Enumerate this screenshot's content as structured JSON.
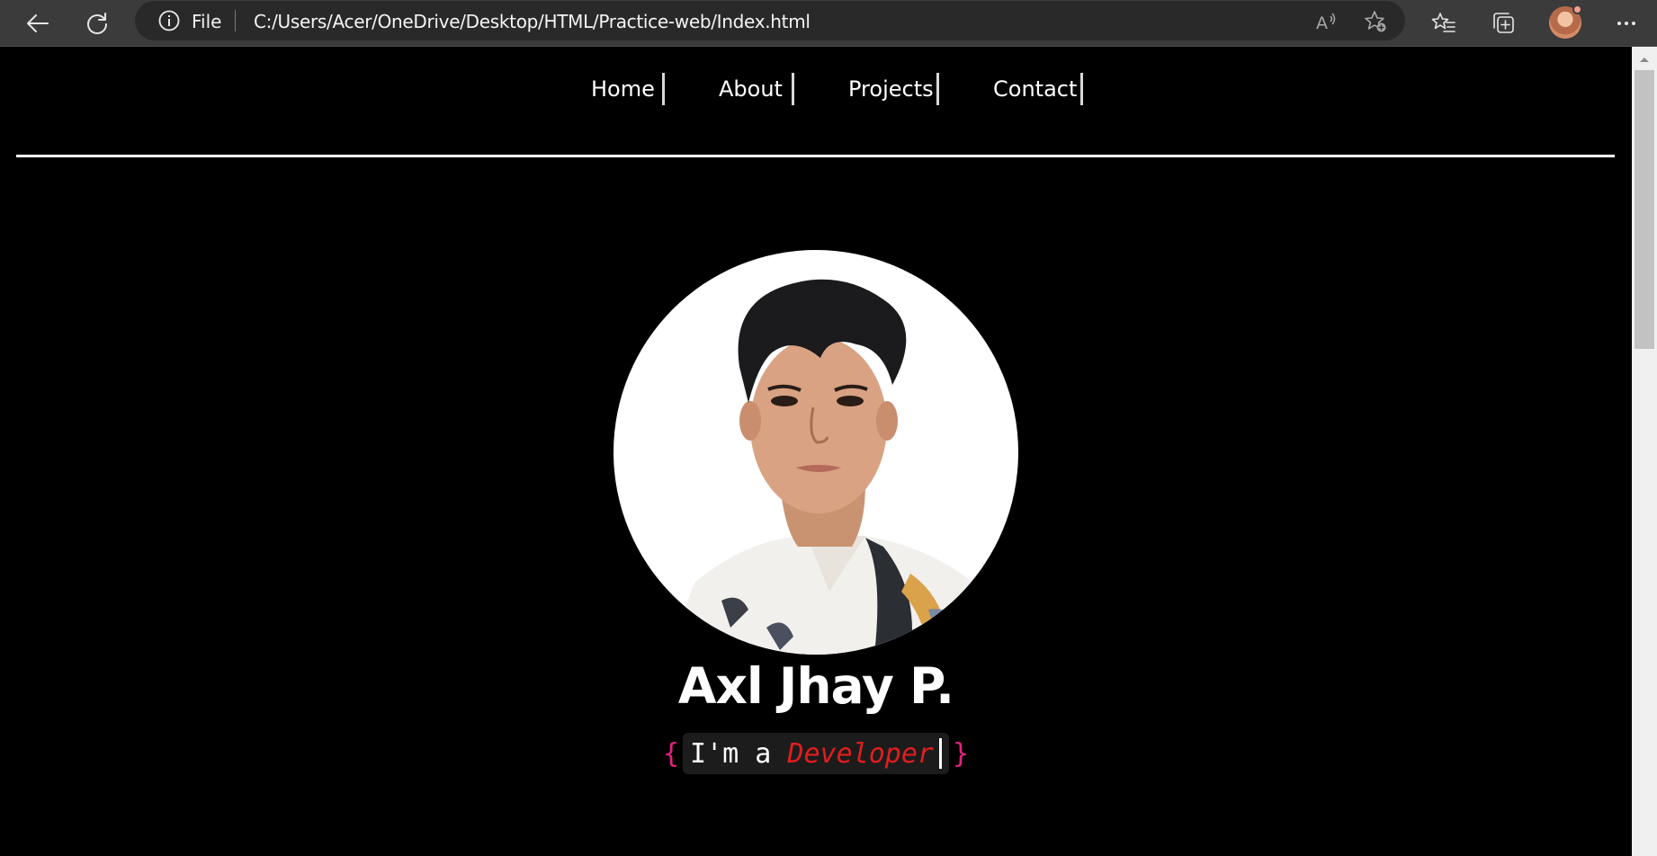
{
  "browser": {
    "protocol_label": "File",
    "url": "C:/Users/Acer/OneDrive/Desktop/HTML/Practice-web/Index.html",
    "icons": [
      "back-icon",
      "refresh-icon",
      "info-icon",
      "read-aloud-icon",
      "add-favorite-icon",
      "favorites-icon",
      "collections-icon",
      "profile-avatar",
      "more-icon"
    ]
  },
  "nav": {
    "items": [
      {
        "label": "Home"
      },
      {
        "label": "About"
      },
      {
        "label": "Projects"
      },
      {
        "label": "Contact"
      }
    ]
  },
  "hero": {
    "name": "Axl Jhay P.",
    "tagline": {
      "open_brace": "{",
      "prefix": "I'm a ",
      "role": "Developer",
      "close_brace": "}"
    }
  },
  "colors": {
    "background": "#000000",
    "brace": "#e6217f",
    "role": "#e01e1e",
    "text": "#ffffff",
    "chrome": "#3b3b3b"
  }
}
